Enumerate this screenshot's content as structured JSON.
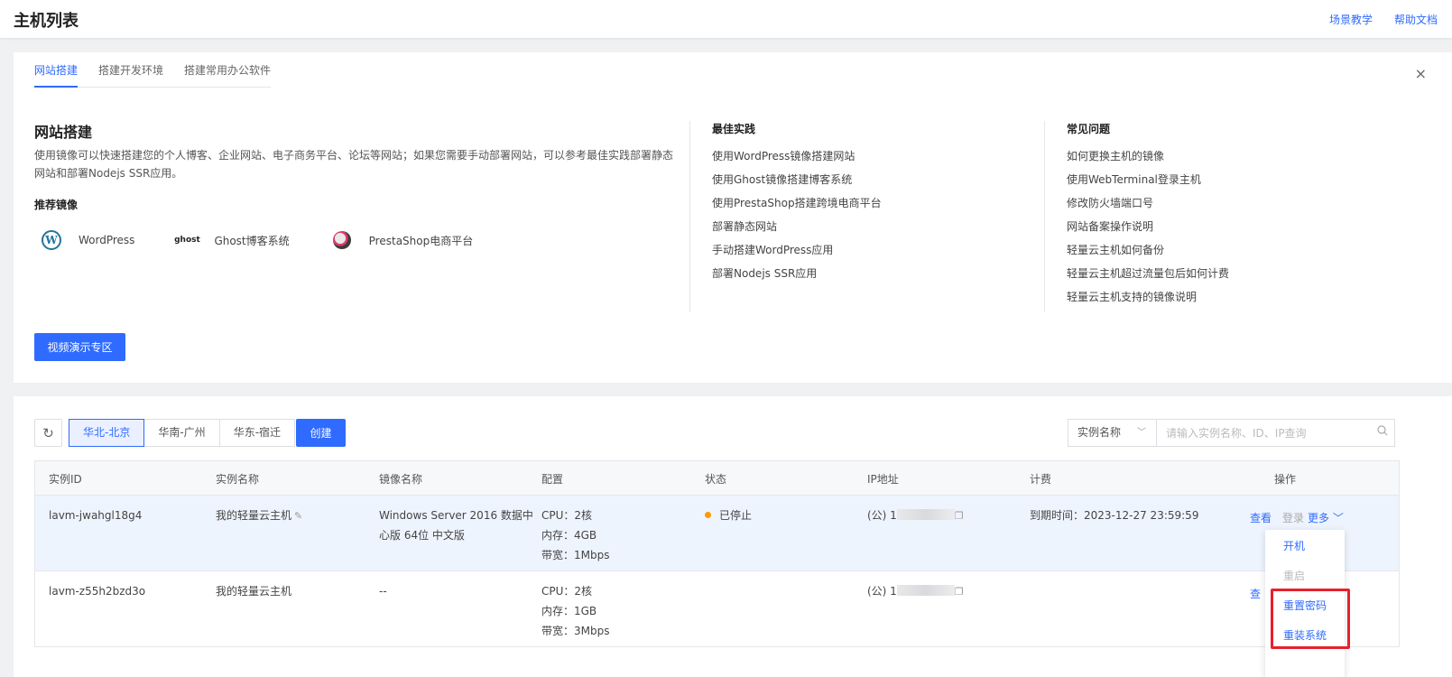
{
  "header": {
    "title": "主机列表",
    "links": [
      "场景教学",
      "帮助文档"
    ]
  },
  "guide": {
    "tabs": [
      "网站搭建",
      "搭建开发环境",
      "搭建常用办公软件"
    ],
    "active_tab": "网站搭建",
    "close_icon": "×",
    "title": "网站搭建",
    "description": "使用镜像可以快速搭建您的个人博客、企业网站、电子商务平台、论坛等网站；如果您需要手动部署网站，可以参考最佳实践部署静态网站和部署Nodejs SSR应用。",
    "recommended_title": "推荐镜像",
    "images": [
      {
        "name": "WordPress",
        "icon": "wordpress-logo",
        "glyph": "W"
      },
      {
        "name": "Ghost博客系统",
        "icon": "ghost-logo",
        "glyph": "ghost"
      },
      {
        "name": "PrestaShop电商平台",
        "icon": "prestashop-logo",
        "glyph": ""
      }
    ],
    "best_practice": {
      "title": "最佳实践",
      "items": [
        "使用WordPress镜像搭建网站",
        "使用Ghost镜像搭建博客系统",
        "使用PrestaShop搭建跨境电商平台",
        "部署静态网站",
        "手动搭建WordPress应用",
        "部署Nodejs SSR应用"
      ]
    },
    "faq": {
      "title": "常见问题",
      "items": [
        "如何更换主机的镜像",
        "使用WebTerminal登录主机",
        "修改防火墙端口号",
        "网站备案操作说明",
        "轻量云主机如何备份",
        "轻量云主机超过流量包后如何计费",
        "轻量云主机支持的镜像说明"
      ]
    },
    "video_button": "视频演示专区"
  },
  "toolbar": {
    "refresh_icon": "↻",
    "regions": [
      "华北-北京",
      "华南-广州",
      "华东-宿迁"
    ],
    "active_region": "华北-北京",
    "create_button": "创建",
    "search_field": "实例名称",
    "search_field_chevron": "﹀",
    "search_placeholder": "请输入实例名称、ID、IP查询"
  },
  "table": {
    "columns": [
      "实例ID",
      "实例名称",
      "镜像名称",
      "配置",
      "状态",
      "IP地址",
      "计费",
      "操作"
    ],
    "rows": [
      {
        "id": "lavm-jwahgl18g4",
        "name": "我的轻量云主机",
        "image_line1": "Windows Server 2016 数据中",
        "image_line2": "心版 64位 中文版",
        "cpu": "CPU：2核",
        "memory": "内存：4GB",
        "bandwidth": "带宽：1Mbps",
        "status": "已停止",
        "ip_prefix": "(公) 1",
        "billing": "到期时间：2023-12-27 23:59:59",
        "actions": {
          "view": "查看",
          "login": "登录",
          "more": "更多"
        }
      },
      {
        "id": "lavm-z55h2bzd3o",
        "name": "我的轻量云主机",
        "image_line1": "--",
        "cpu": "CPU：2核",
        "memory": "内存：1GB",
        "bandwidth": "带宽：3Mbps",
        "status": "",
        "ip_prefix": "(公) 1",
        "billing": "",
        "actions": {
          "view": "查"
        }
      }
    ]
  },
  "more_menu": {
    "items": [
      {
        "label": "开机",
        "enabled": true
      },
      {
        "label": "重启",
        "enabled": false
      },
      {
        "label": "重置密码",
        "enabled": true
      },
      {
        "label": "重装系统",
        "enabled": true
      }
    ]
  },
  "colors": {
    "accent": "#2f6bff",
    "status_stopped": "#ff9a00",
    "highlight_box": "#e8202d"
  }
}
